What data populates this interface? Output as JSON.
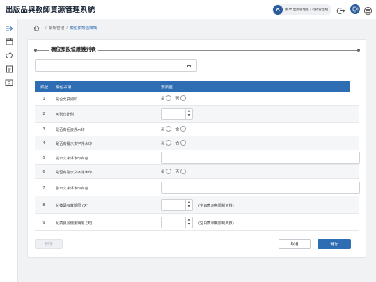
{
  "app": {
    "title": "出版品與教師資源管理系統",
    "user": {
      "avatar_letter": "A",
      "name": "藝學 出版管理組 / 行銷管理組"
    }
  },
  "icons": {
    "logout": "logout-icon",
    "theme": "sun-icon",
    "controls": "toggle-panel-icon",
    "sidebar": [
      "collapse-menu-icon",
      "calendar-icon",
      "hand-icon",
      "document-icon",
      "certificate-icon"
    ],
    "home": "home-icon",
    "select_chevron": "chevron-up-icon"
  },
  "colors": {
    "primary": "#2e6db4",
    "avatar": "#2a5b9a"
  },
  "breadcrumb": {
    "home": "⌂",
    "items": [
      "系統管理",
      "欄位預設值維護"
    ]
  },
  "section": {
    "title": "欄位預設值維護列表"
  },
  "filter": {
    "value": ""
  },
  "table": {
    "headers": {
      "num": "編號",
      "name": "欄位名稱",
      "value": "預設值"
    },
    "rows": [
      {
        "num": "1",
        "name": "是否允許列印",
        "type": "radio",
        "yes": "是",
        "no": "否"
      },
      {
        "num": "2",
        "name": "可列印比例",
        "type": "stepper",
        "value": ""
      },
      {
        "num": "3",
        "name": "是否有個資浮水印",
        "type": "radio",
        "yes": "是",
        "no": "否"
      },
      {
        "num": "4",
        "name": "是否有提示文字浮水印",
        "type": "radio",
        "yes": "是",
        "no": "否"
      },
      {
        "num": "5",
        "name": "提示文字浮水印內容",
        "type": "text",
        "value": ""
      },
      {
        "num": "6",
        "name": "是否有警示文字浮水印",
        "type": "radio",
        "yes": "是",
        "no": "否"
      },
      {
        "num": "7",
        "name": "警示文字浮水印內容",
        "type": "text",
        "value": ""
      },
      {
        "num": "8",
        "name": "兌換碼有效期限 (天)",
        "type": "stepper",
        "value": "",
        "hint": "(空白表示無限制天數)"
      },
      {
        "num": "9",
        "name": "兌換資源使用期限 (天)",
        "type": "stepper",
        "value": "",
        "hint": "(空白表示無限制天數)"
      }
    ]
  },
  "buttons": {
    "delete": "刪除",
    "cancel": "取消",
    "save": "儲存"
  }
}
